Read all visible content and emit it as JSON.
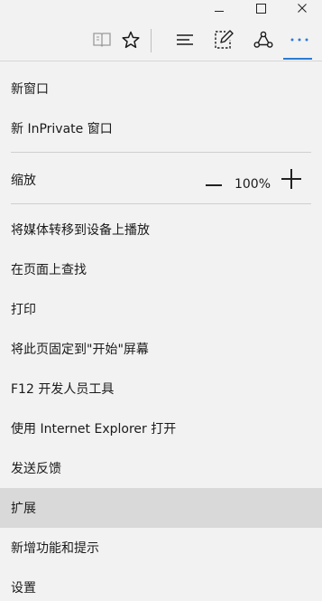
{
  "titlebar": {
    "minimize_icon": "minimize-icon",
    "maximize_icon": "maximize-icon",
    "close_icon": "close-icon"
  },
  "toolbar": {
    "icons": [
      "reading-view-icon",
      "favorite-star-icon",
      "hub-icon",
      "web-note-icon",
      "share-icon",
      "more-actions-icon"
    ],
    "more_label": "···",
    "active_color": "#2b7cd3"
  },
  "menu": {
    "new_window": "新窗口",
    "new_inprivate_window": "新 InPrivate 窗口",
    "zoom_label": "缩放",
    "zoom_value": "100%",
    "cast_media": "将媒体转移到设备上播放",
    "find_on_page": "在页面上查找",
    "print": "打印",
    "pin_to_start": "将此页固定到\"开始\"屏幕",
    "f12_dev_tools": "F12 开发人员工具",
    "open_with_ie": "使用 Internet Explorer 打开",
    "send_feedback": "发送反馈",
    "extensions": "扩展",
    "whats_new_tips": "新增功能和提示",
    "settings": "设置",
    "highlighted_item": "extensions"
  }
}
